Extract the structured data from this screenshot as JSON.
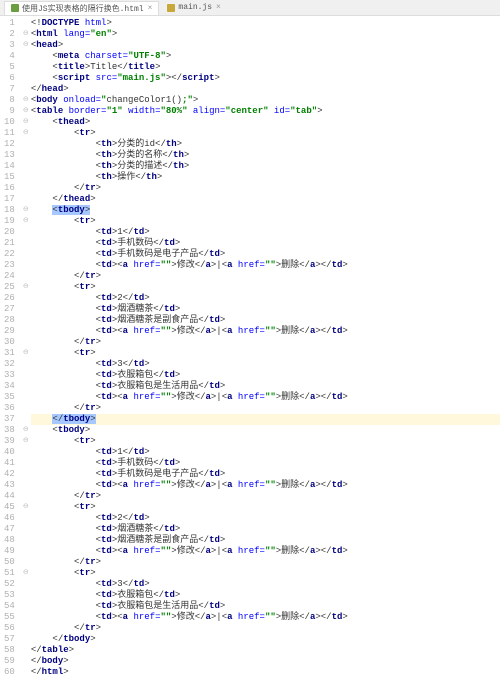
{
  "tabs": [
    {
      "label": "使用JS实现表格的隔行换色.html",
      "active": true,
      "icon": "html"
    },
    {
      "label": "main.js",
      "active": false,
      "icon": "js"
    }
  ],
  "highlighted_line": 37,
  "lines": [
    {
      "n": 1,
      "indent": 0,
      "html": "&lt;!<span class='tag'>DOCTYPE</span> <span class='attr'>html</span>&gt;"
    },
    {
      "n": 2,
      "indent": 0,
      "html": "&lt;<span class='tag'>html</span> <span class='attr'>lang=</span><span class='val'>\"en\"</span>&gt;"
    },
    {
      "n": 3,
      "indent": 0,
      "html": "&lt;<span class='tag'>head</span>&gt;"
    },
    {
      "n": 4,
      "indent": 2,
      "html": "&lt;<span class='tag'>meta</span> <span class='attr'>charset=</span><span class='val'>\"UTF-8\"</span>&gt;"
    },
    {
      "n": 5,
      "indent": 2,
      "html": "&lt;<span class='tag'>title</span>&gt;Title&lt;/<span class='tag'>title</span>&gt;"
    },
    {
      "n": 6,
      "indent": 2,
      "html": "&lt;<span class='tag'>script</span> <span class='attr'>src=</span><span class='val'>\"main.js\"</span>&gt;&lt;/<span class='tag'>script</span>&gt;"
    },
    {
      "n": 7,
      "indent": 0,
      "html": "&lt;/<span class='tag'>head</span>&gt;"
    },
    {
      "n": 8,
      "indent": 0,
      "html": "&lt;<span class='tag'>body</span> <span class='attr'>onload=</span><span class='val'>\"</span><span class='func'>changeColor1()</span><span class='val'>;\"</span>&gt;"
    },
    {
      "n": 9,
      "indent": 0,
      "html": "&lt;<span class='tag'>table</span> <span class='attr'>border=</span><span class='val'>\"1\"</span> <span class='attr'>width=</span><span class='val'>\"80%\"</span> <span class='attr'>align=</span><span class='val'>\"center\"</span> <span class='attr'>id=</span><span class='val'>\"tab\"</span>&gt;"
    },
    {
      "n": 10,
      "indent": 2,
      "html": "&lt;<span class='tag'>thead</span>&gt;"
    },
    {
      "n": 11,
      "indent": 4,
      "html": "&lt;<span class='tag'>tr</span>&gt;"
    },
    {
      "n": 12,
      "indent": 6,
      "html": "&lt;<span class='tag'>th</span>&gt;分类的id&lt;/<span class='tag'>th</span>&gt;"
    },
    {
      "n": 13,
      "indent": 6,
      "html": "&lt;<span class='tag'>th</span>&gt;分类的名称&lt;/<span class='tag'>th</span>&gt;"
    },
    {
      "n": 14,
      "indent": 6,
      "html": "&lt;<span class='tag'>th</span>&gt;分类的描述&lt;/<span class='tag'>th</span>&gt;"
    },
    {
      "n": 15,
      "indent": 6,
      "html": "&lt;<span class='tag'>th</span>&gt;操作&lt;/<span class='tag'>th</span>&gt;"
    },
    {
      "n": 16,
      "indent": 4,
      "html": "&lt;/<span class='tag'>tr</span>&gt;"
    },
    {
      "n": 17,
      "indent": 2,
      "html": "&lt;/<span class='tag'>thead</span>&gt;"
    },
    {
      "n": 18,
      "indent": 2,
      "html": "<span class='sel'>&lt;<span class='tag'>tbody</span>&gt;</span>"
    },
    {
      "n": 19,
      "indent": 4,
      "html": "&lt;<span class='tag'>tr</span>&gt;"
    },
    {
      "n": 20,
      "indent": 6,
      "html": "&lt;<span class='tag'>td</span>&gt;1&lt;/<span class='tag'>td</span>&gt;"
    },
    {
      "n": 21,
      "indent": 6,
      "html": "&lt;<span class='tag'>td</span>&gt;手机数码&lt;/<span class='tag'>td</span>&gt;"
    },
    {
      "n": 22,
      "indent": 6,
      "html": "&lt;<span class='tag'>td</span>&gt;手机数码是电子产品&lt;/<span class='tag'>td</span>&gt;"
    },
    {
      "n": 23,
      "indent": 6,
      "html": "&lt;<span class='tag'>td</span>&gt;&lt;<span class='tag'>a</span> <span class='attr'>href=</span><span class='val'>\"\"</span>&gt;修改&lt;/<span class='tag'>a</span>&gt;|&lt;<span class='tag'>a</span> <span class='attr'>href=</span><span class='val'>\"\"</span>&gt;删除&lt;/<span class='tag'>a</span>&gt;&lt;/<span class='tag'>td</span>&gt;"
    },
    {
      "n": 24,
      "indent": 4,
      "html": "&lt;/<span class='tag'>tr</span>&gt;"
    },
    {
      "n": 25,
      "indent": 4,
      "html": "&lt;<span class='tag'>tr</span>&gt;"
    },
    {
      "n": 26,
      "indent": 6,
      "html": "&lt;<span class='tag'>td</span>&gt;2&lt;/<span class='tag'>td</span>&gt;"
    },
    {
      "n": 27,
      "indent": 6,
      "html": "&lt;<span class='tag'>td</span>&gt;烟酒糖茶&lt;/<span class='tag'>td</span>&gt;"
    },
    {
      "n": 28,
      "indent": 6,
      "html": "&lt;<span class='tag'>td</span>&gt;烟酒糖茶是副食产品&lt;/<span class='tag'>td</span>&gt;"
    },
    {
      "n": 29,
      "indent": 6,
      "html": "&lt;<span class='tag'>td</span>&gt;&lt;<span class='tag'>a</span> <span class='attr'>href=</span><span class='val'>\"\"</span>&gt;修改&lt;/<span class='tag'>a</span>&gt;|&lt;<span class='tag'>a</span> <span class='attr'>href=</span><span class='val'>\"\"</span>&gt;删除&lt;/<span class='tag'>a</span>&gt;&lt;/<span class='tag'>td</span>&gt;"
    },
    {
      "n": 30,
      "indent": 4,
      "html": "&lt;/<span class='tag'>tr</span>&gt;"
    },
    {
      "n": 31,
      "indent": 4,
      "html": "&lt;<span class='tag'>tr</span>&gt;"
    },
    {
      "n": 32,
      "indent": 6,
      "html": "&lt;<span class='tag'>td</span>&gt;3&lt;/<span class='tag'>td</span>&gt;"
    },
    {
      "n": 33,
      "indent": 6,
      "html": "&lt;<span class='tag'>td</span>&gt;衣服箱包&lt;/<span class='tag'>td</span>&gt;"
    },
    {
      "n": 34,
      "indent": 6,
      "html": "&lt;<span class='tag'>td</span>&gt;衣服箱包是生活用品&lt;/<span class='tag'>td</span>&gt;"
    },
    {
      "n": 35,
      "indent": 6,
      "html": "&lt;<span class='tag'>td</span>&gt;&lt;<span class='tag'>a</span> <span class='attr'>href=</span><span class='val'>\"\"</span>&gt;修改&lt;/<span class='tag'>a</span>&gt;|&lt;<span class='tag'>a</span> <span class='attr'>href=</span><span class='val'>\"\"</span>&gt;删除&lt;/<span class='tag'>a</span>&gt;&lt;/<span class='tag'>td</span>&gt;"
    },
    {
      "n": 36,
      "indent": 4,
      "html": "&lt;/<span class='tag'>tr</span>&gt;"
    },
    {
      "n": 37,
      "indent": 2,
      "html": "<span class='sel'>&lt;/<span class='tag'>tbody</span>&gt;</span>"
    },
    {
      "n": 38,
      "indent": 2,
      "html": "&lt;<span class='tag'>tbody</span>&gt;"
    },
    {
      "n": 39,
      "indent": 4,
      "html": "&lt;<span class='tag'>tr</span>&gt;"
    },
    {
      "n": 40,
      "indent": 6,
      "html": "&lt;<span class='tag'>td</span>&gt;1&lt;/<span class='tag'>td</span>&gt;"
    },
    {
      "n": 41,
      "indent": 6,
      "html": "&lt;<span class='tag'>td</span>&gt;手机数码&lt;/<span class='tag'>td</span>&gt;"
    },
    {
      "n": 42,
      "indent": 6,
      "html": "&lt;<span class='tag'>td</span>&gt;手机数码是电子产品&lt;/<span class='tag'>td</span>&gt;"
    },
    {
      "n": 43,
      "indent": 6,
      "html": "&lt;<span class='tag'>td</span>&gt;&lt;<span class='tag'>a</span> <span class='attr'>href=</span><span class='val'>\"\"</span>&gt;修改&lt;/<span class='tag'>a</span>&gt;|&lt;<span class='tag'>a</span> <span class='attr'>href=</span><span class='val'>\"\"</span>&gt;删除&lt;/<span class='tag'>a</span>&gt;&lt;/<span class='tag'>td</span>&gt;"
    },
    {
      "n": 44,
      "indent": 4,
      "html": "&lt;/<span class='tag'>tr</span>&gt;"
    },
    {
      "n": 45,
      "indent": 4,
      "html": "&lt;<span class='tag'>tr</span>&gt;"
    },
    {
      "n": 46,
      "indent": 6,
      "html": "&lt;<span class='tag'>td</span>&gt;2&lt;/<span class='tag'>td</span>&gt;"
    },
    {
      "n": 47,
      "indent": 6,
      "html": "&lt;<span class='tag'>td</span>&gt;烟酒糖茶&lt;/<span class='tag'>td</span>&gt;"
    },
    {
      "n": 48,
      "indent": 6,
      "html": "&lt;<span class='tag'>td</span>&gt;烟酒糖茶是副食产品&lt;/<span class='tag'>td</span>&gt;"
    },
    {
      "n": 49,
      "indent": 6,
      "html": "&lt;<span class='tag'>td</span>&gt;&lt;<span class='tag'>a</span> <span class='attr'>href=</span><span class='val'>\"\"</span>&gt;修改&lt;/<span class='tag'>a</span>&gt;|&lt;<span class='tag'>a</span> <span class='attr'>href=</span><span class='val'>\"\"</span>&gt;删除&lt;/<span class='tag'>a</span>&gt;&lt;/<span class='tag'>td</span>&gt;"
    },
    {
      "n": 50,
      "indent": 4,
      "html": "&lt;/<span class='tag'>tr</span>&gt;"
    },
    {
      "n": 51,
      "indent": 4,
      "html": "&lt;<span class='tag'>tr</span>&gt;"
    },
    {
      "n": 52,
      "indent": 6,
      "html": "&lt;<span class='tag'>td</span>&gt;3&lt;/<span class='tag'>td</span>&gt;"
    },
    {
      "n": 53,
      "indent": 6,
      "html": "&lt;<span class='tag'>td</span>&gt;衣服箱包&lt;/<span class='tag'>td</span>&gt;"
    },
    {
      "n": 54,
      "indent": 6,
      "html": "&lt;<span class='tag'>td</span>&gt;衣服箱包是生活用品&lt;/<span class='tag'>td</span>&gt;"
    },
    {
      "n": 55,
      "indent": 6,
      "html": "&lt;<span class='tag'>td</span>&gt;&lt;<span class='tag'>a</span> <span class='attr'>href=</span><span class='val'>\"\"</span>&gt;修改&lt;/<span class='tag'>a</span>&gt;|&lt;<span class='tag'>a</span> <span class='attr'>href=</span><span class='val'>\"\"</span>&gt;删除&lt;/<span class='tag'>a</span>&gt;&lt;/<span class='tag'>td</span>&gt;"
    },
    {
      "n": 56,
      "indent": 4,
      "html": "&lt;/<span class='tag'>tr</span>&gt;"
    },
    {
      "n": 57,
      "indent": 2,
      "html": "&lt;/<span class='tag'>tbody</span>&gt;"
    },
    {
      "n": 58,
      "indent": 0,
      "html": "&lt;/<span class='tag'>table</span>&gt;"
    },
    {
      "n": 59,
      "indent": 0,
      "html": "&lt;/<span class='tag'>body</span>&gt;"
    },
    {
      "n": 60,
      "indent": 0,
      "html": "&lt;/<span class='tag'>html</span>&gt;"
    }
  ]
}
